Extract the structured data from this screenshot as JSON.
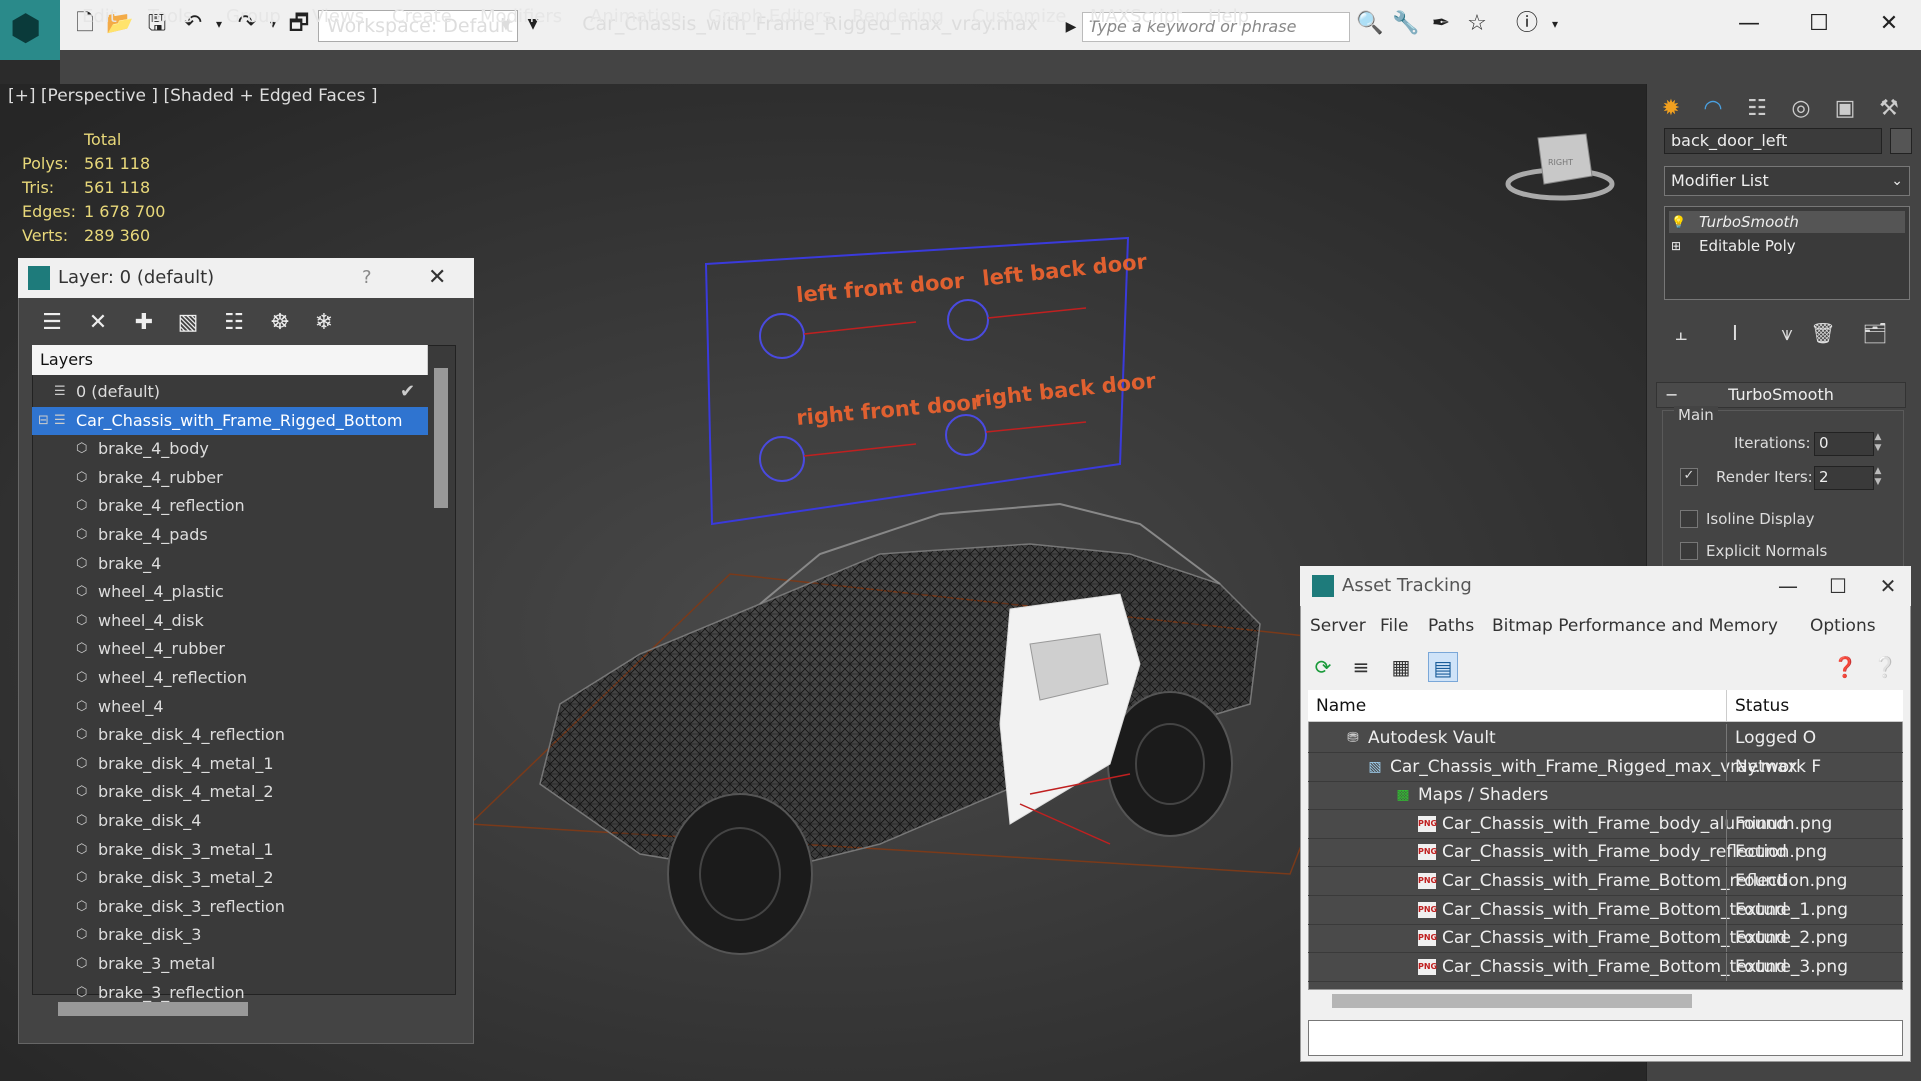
{
  "titlebar": {
    "workspace_label": "Workspace: Default",
    "file_title": "Car_Chassis_with_Frame_Rigged_max_vray.max",
    "search_placeholder": "Type a keyword or phrase"
  },
  "menu": [
    "Edit",
    "Tools",
    "Group",
    "Views",
    "Create",
    "Modifiers",
    "Animation",
    "Graph Editors",
    "Rendering",
    "Customize",
    "MAXScript",
    "Help"
  ],
  "viewport": {
    "label": "[+] [Perspective ] [Shaded + Edged Faces ]",
    "stats_header": "Total",
    "stats": [
      {
        "label": "Polys:",
        "value": "561 118"
      },
      {
        "label": "Tris:",
        "value": "561 118"
      },
      {
        "label": "Edges:",
        "value": "1 678 700"
      },
      {
        "label": "Verts:",
        "value": "289 360"
      }
    ],
    "board_labels": [
      "left front door",
      "left back door",
      "right front door",
      "right back door"
    ],
    "viewcube_text": "RIGHT"
  },
  "command_panel": {
    "object_name": "back_door_left",
    "modifier_list": "Modifier List",
    "stack": [
      "TurboSmooth",
      "Editable Poly"
    ],
    "turbosmooth": {
      "title": "TurboSmooth",
      "group": "Main",
      "iterations_label": "Iterations:",
      "iterations_value": "0",
      "render_iters_label": "Render Iters:",
      "render_iters_value": "2",
      "isoline_label": "Isoline Display",
      "explicit_normals_label": "Explicit Normals"
    }
  },
  "layer_dialog": {
    "title": "Layer: 0 (default)",
    "help": "?",
    "header": "Layers",
    "rows": [
      {
        "name": "0 (default)",
        "level": 0
      },
      {
        "name": "Car_Chassis_with_Frame_Rigged_Bottom",
        "level": 0,
        "selected": true
      },
      {
        "name": "brake_4_body",
        "level": 1
      },
      {
        "name": "brake_4_rubber",
        "level": 1
      },
      {
        "name": "brake_4_reflection",
        "level": 1
      },
      {
        "name": "brake_4_pads",
        "level": 1
      },
      {
        "name": "brake_4",
        "level": 1
      },
      {
        "name": "wheel_4_plastic",
        "level": 1
      },
      {
        "name": "wheel_4_disk",
        "level": 1
      },
      {
        "name": "wheel_4_rubber",
        "level": 1
      },
      {
        "name": "wheel_4_reflection",
        "level": 1
      },
      {
        "name": "wheel_4",
        "level": 1
      },
      {
        "name": "brake_disk_4_reflection",
        "level": 1
      },
      {
        "name": "brake_disk_4_metal_1",
        "level": 1
      },
      {
        "name": "brake_disk_4_metal_2",
        "level": 1
      },
      {
        "name": "brake_disk_4",
        "level": 1
      },
      {
        "name": "brake_disk_3_metal_1",
        "level": 1
      },
      {
        "name": "brake_disk_3_metal_2",
        "level": 1
      },
      {
        "name": "brake_disk_3_reflection",
        "level": 1
      },
      {
        "name": "brake_disk_3",
        "level": 1
      },
      {
        "name": "brake_3_metal",
        "level": 1
      },
      {
        "name": "brake_3_reflection",
        "level": 1
      }
    ]
  },
  "asset_tracking": {
    "title": "Asset Tracking",
    "menu": [
      "Server",
      "File",
      "Paths",
      "Bitmap Performance and Memory",
      "Options"
    ],
    "col_name": "Name",
    "col_status": "Status",
    "rows": [
      {
        "name": "Autodesk Vault",
        "status": "Logged O",
        "level": 0,
        "icon": "vault"
      },
      {
        "name": "Car_Chassis_with_Frame_Rigged_max_vray.max",
        "status": "Network F",
        "level": 1,
        "icon": "max"
      },
      {
        "name": "Maps / Shaders",
        "status": "",
        "level": 2,
        "icon": "maps"
      },
      {
        "name": "Car_Chassis_with_Frame_body_aluminum.png",
        "status": "Found",
        "level": 3,
        "icon": "png"
      },
      {
        "name": "Car_Chassis_with_Frame_body_reflection.png",
        "status": "Found",
        "level": 3,
        "icon": "png"
      },
      {
        "name": "Car_Chassis_with_Frame_Bottom_reflection.png",
        "status": "Found",
        "level": 3,
        "icon": "png"
      },
      {
        "name": "Car_Chassis_with_Frame_Bottom_texture_1.png",
        "status": "Found",
        "level": 3,
        "icon": "png"
      },
      {
        "name": "Car_Chassis_with_Frame_Bottom_texture_2.png",
        "status": "Found",
        "level": 3,
        "icon": "png"
      },
      {
        "name": "Car_Chassis_with_Frame_Bottom_texture_3.png",
        "status": "Found",
        "level": 3,
        "icon": "png"
      }
    ]
  },
  "colors": {
    "accent_blue": "#2f74d0",
    "stat_yellow": "#e8d87a",
    "board_text": "#e06030",
    "board_frame": "#3a3adc"
  }
}
